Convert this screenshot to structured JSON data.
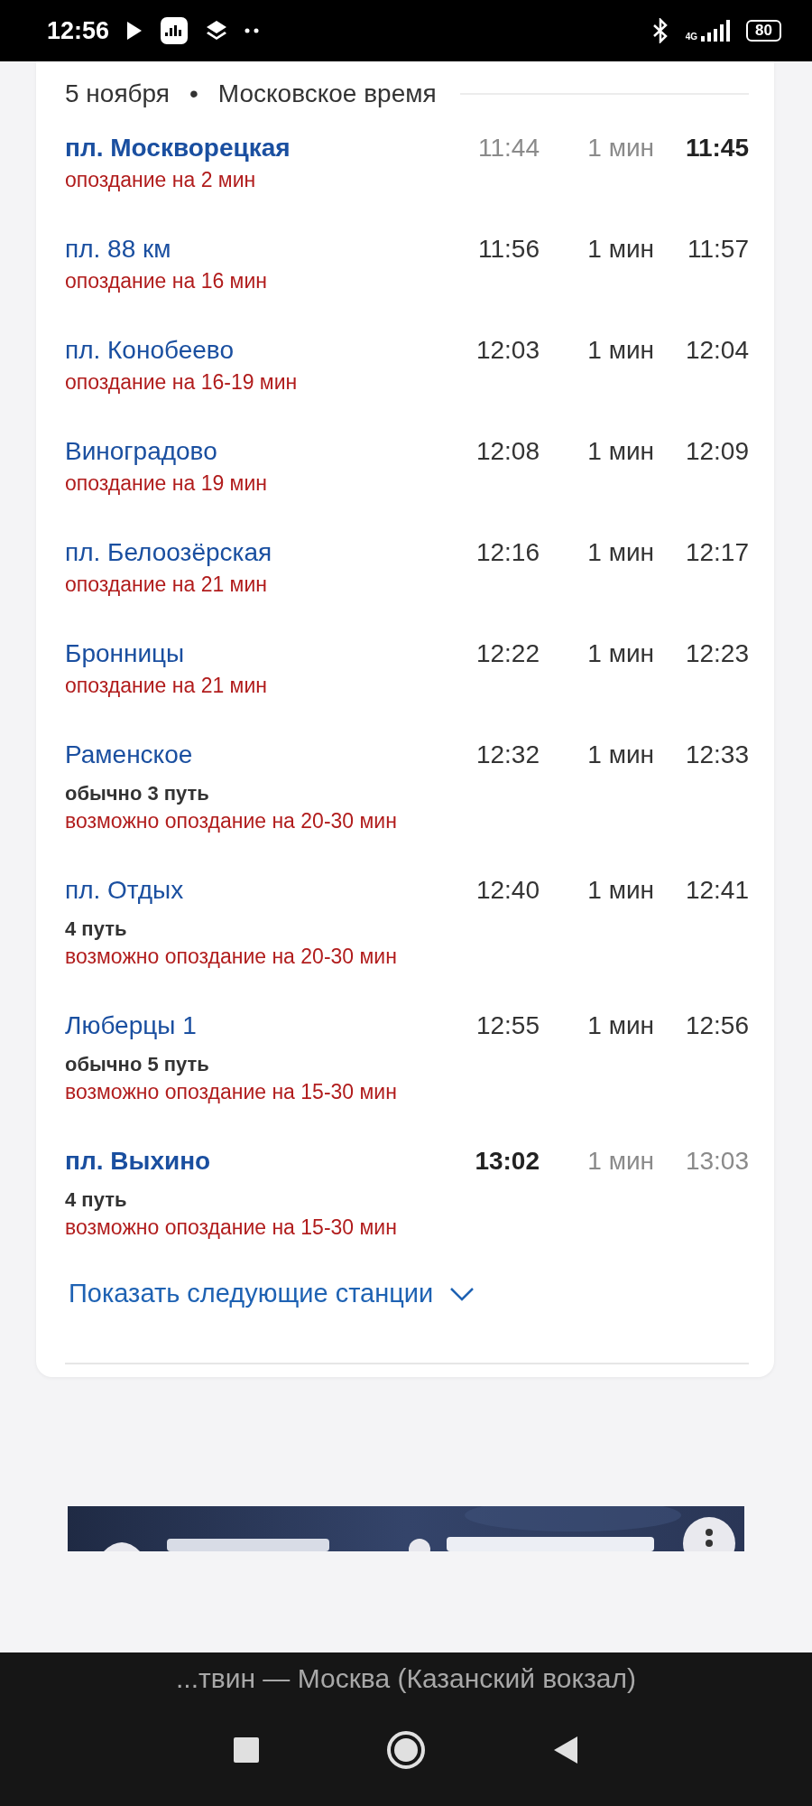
{
  "status_bar": {
    "time": "12:56",
    "network": "4G",
    "battery": "80"
  },
  "schedule": {
    "date": "5 ноября",
    "separator": "•",
    "timezone": "Московское время",
    "rows": [
      {
        "kind": "start",
        "station": "пл. Москворецкая",
        "arrival": "11:44",
        "stop": "1 мин",
        "departure": "11:45",
        "notes": [
          {
            "kind": "delay",
            "text": "опоздание на 2 мин"
          }
        ]
      },
      {
        "kind": "normal",
        "station": "пл. 88 км",
        "arrival": "11:56",
        "stop": "1 мин",
        "departure": "11:57",
        "notes": [
          {
            "kind": "delay",
            "text": "опоздание на 16 мин"
          }
        ]
      },
      {
        "kind": "normal",
        "station": "пл. Конобеево",
        "arrival": "12:03",
        "stop": "1 мин",
        "departure": "12:04",
        "notes": [
          {
            "kind": "delay",
            "text": "опоздание на 16-19 мин"
          }
        ]
      },
      {
        "kind": "normal",
        "station": "Виноградово",
        "arrival": "12:08",
        "stop": "1 мин",
        "departure": "12:09",
        "notes": [
          {
            "kind": "delay",
            "text": "опоздание на 19 мин"
          }
        ]
      },
      {
        "kind": "normal",
        "station": "пл. Белоозёрская",
        "arrival": "12:16",
        "stop": "1 мин",
        "departure": "12:17",
        "notes": [
          {
            "kind": "delay",
            "text": "опоздание на 21 мин"
          }
        ]
      },
      {
        "kind": "normal",
        "station": "Бронницы",
        "arrival": "12:22",
        "stop": "1 мин",
        "departure": "12:23",
        "notes": [
          {
            "kind": "delay",
            "text": "опоздание на 21 мин"
          }
        ]
      },
      {
        "kind": "normal",
        "station": "Раменское",
        "arrival": "12:32",
        "stop": "1 мин",
        "departure": "12:33",
        "notes": [
          {
            "kind": "track",
            "text": "обычно 3 путь"
          },
          {
            "kind": "delay",
            "text": "возможно опоздание на 20-30 мин"
          }
        ]
      },
      {
        "kind": "normal",
        "station": "пл. Отдых",
        "arrival": "12:40",
        "stop": "1 мин",
        "departure": "12:41",
        "notes": [
          {
            "kind": "track",
            "text": "4 путь"
          },
          {
            "kind": "delay",
            "text": "возможно опоздание на 20-30 мин"
          }
        ]
      },
      {
        "kind": "normal",
        "station": "Люберцы 1",
        "arrival": "12:55",
        "stop": "1 мин",
        "departure": "12:56",
        "notes": [
          {
            "kind": "track",
            "text": "обычно 5 путь"
          },
          {
            "kind": "delay",
            "text": "возможно опоздание на 15-30 мин"
          }
        ]
      },
      {
        "kind": "end",
        "station": "пл. Выхино",
        "arrival": "13:02",
        "stop": "1 мин",
        "departure": "13:03",
        "notes": [
          {
            "kind": "track",
            "text": "4 путь"
          },
          {
            "kind": "delay",
            "text": "возможно опоздание на 15-30 мин"
          }
        ]
      }
    ],
    "show_more": "Показать следующие станции"
  },
  "bottom_bar": {
    "title": "...твин — Москва (Казанский вокзал)"
  }
}
